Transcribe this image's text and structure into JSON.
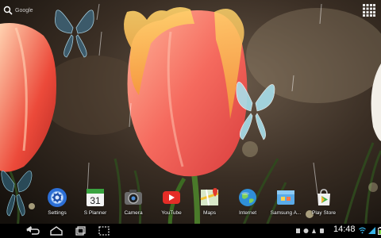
{
  "search": {
    "label": "Google"
  },
  "dock": {
    "apps": [
      {
        "id": "settings",
        "label": "Settings",
        "icon": "settings-gear-icon"
      },
      {
        "id": "splanner",
        "label": "S Planner",
        "icon": "calendar-icon",
        "date": "31"
      },
      {
        "id": "camera",
        "label": "Camera",
        "icon": "camera-icon"
      },
      {
        "id": "youtube",
        "label": "YouTube",
        "icon": "youtube-icon"
      },
      {
        "id": "maps",
        "label": "Maps",
        "icon": "maps-icon"
      },
      {
        "id": "internet",
        "label": "Internet",
        "icon": "globe-icon"
      },
      {
        "id": "samsungapps",
        "label": "Samsung A...",
        "icon": "samsung-apps-icon"
      },
      {
        "id": "playstore",
        "label": "Play Store",
        "icon": "play-store-icon"
      }
    ]
  },
  "status": {
    "time": "14:48"
  },
  "colors": {
    "tulip": "#ff6f61",
    "navbar": "#000000",
    "butterfly": "#9fd8e8"
  }
}
